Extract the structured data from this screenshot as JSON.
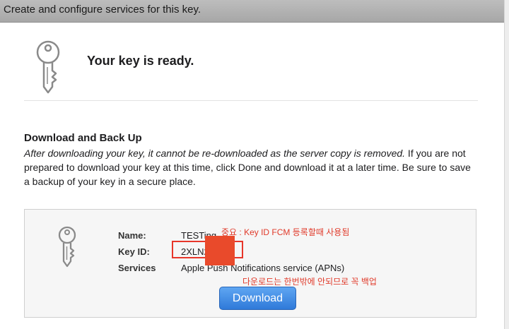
{
  "header": {
    "title": "Create and configure services for this key."
  },
  "ready": {
    "title": "Your key is ready."
  },
  "section": {
    "heading": "Download and Back Up",
    "italic_text": "After downloading your key, it cannot be re-downloaded as the server copy is removed.",
    "body_text": " If you are not prepared to download your key at this time, click Done and download it at a later time. Be sure to save a backup of your key in a secure place."
  },
  "key": {
    "name_label": "Name:",
    "name_value": "TESTing",
    "keyid_label": "Key ID:",
    "keyid_value": "2XLN2",
    "services_label": "Services",
    "services_value": "Apple Push Notifications service (APNs)"
  },
  "annotations": {
    "top": "중요 : Key ID    FCM 등록할때 사용됨",
    "bottom": "다운로드는 한번밖에 안되므로 꼭 백업"
  },
  "buttons": {
    "download": "Download"
  },
  "icons": {
    "ready": "key-icon",
    "key_box": "key-icon"
  },
  "colors": {
    "annotation": "#e03a2a",
    "button": "#2f7ad9",
    "redaction": "#e94a2b"
  }
}
